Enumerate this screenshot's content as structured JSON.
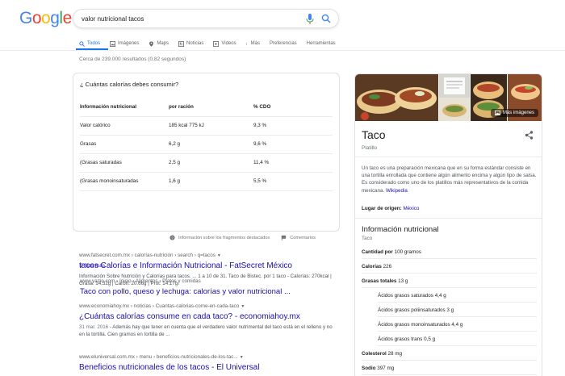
{
  "logo": {
    "letters": [
      "G",
      "o",
      "o",
      "g",
      "l",
      "e"
    ],
    "colors": [
      "#4285F4",
      "#EA4335",
      "#FBBC05",
      "#4285F4",
      "#34A853",
      "#EA4335"
    ]
  },
  "search": {
    "value": "valor nutricional tacos",
    "mic_icon": "mic-icon",
    "search_icon": "search-icon"
  },
  "tabs": [
    {
      "label": "Todos",
      "icon": "search-icon",
      "active": true
    },
    {
      "label": "Imágenes",
      "icon": "image-icon"
    },
    {
      "label": "Maps",
      "icon": "map-pin-icon"
    },
    {
      "label": "Noticias",
      "icon": "news-icon"
    },
    {
      "label": "Videos",
      "icon": "video-icon"
    },
    {
      "label": "Más",
      "icon": "more-icon"
    },
    {
      "label": "Preferencias"
    },
    {
      "label": "Herramientas"
    }
  ],
  "result_stats": "Cerca de 239.000 resultados (0,82 segundos)",
  "featured_snippet": {
    "question": "¿ Cuántas calorías debes consumir?",
    "headers": [
      "Información nutricional",
      "por ración",
      "% CDO"
    ],
    "rows": [
      [
        "Valor calórico",
        "185 kcal 775 kJ",
        "9,3 %"
      ],
      [
        "Grasas",
        "6,2 g",
        "9,6 %"
      ],
      [
        "(Grasas saturadas",
        "2,5 g",
        "11,4 %"
      ],
      [
        "(Grasas monoinsaturadas",
        "1,6 g",
        "5,5 %"
      ]
    ],
    "more_rows": "9 filas más",
    "cite": "www.yazio.com › Inicio › Alimentos › Platos y comidas",
    "title": "Taco con pollo, queso y lechuga: calorías y valor nutricional ..."
  },
  "feedback": {
    "about": "Información sobre los fragmentos destacados",
    "comments": "Comentarios"
  },
  "results": [
    {
      "cite": "www.fatsecret.com.mx › calorías-nutrición › search › q=tacos",
      "title": "tacos Calorías e Información Nutricional - FatSecret México",
      "snippet_date": "",
      "snippet": "Información Sobre Nutrición y Calorías para tacos. ... 1 a 10 de 31. Taco de Bistec. por 1 taco - Calorías: 270kcal | Grasa: 14.52g | Carbh: 20.66g | Prot: 14.17g."
    },
    {
      "cite": "www.economiahoy.mx › noticias › Cuantas-calorias-come-en-cada-taco",
      "title": "¿Cuántas calorías consume en cada taco? - economiahoy.mx",
      "snippet_date": "31 mar. 2016",
      "snippet": " - Además hay que tener en cuenta que el verdadero valor nutrimental del taco está en el relleno y no en la tortilla. Cien gramos en tortilla de ..."
    },
    {
      "cite": "www.eluniversal.com.mx › menu › beneficios-nutricionales-de-los-tac...",
      "title": "Beneficios nutricionales de los tacos - El Universal",
      "snippet_date": "",
      "snippet": ""
    }
  ],
  "knowledge_panel": {
    "more_images": "Más imágenes",
    "title": "Taco",
    "subtitle": "Platillo",
    "description": "Un taco es una preparación mexicana que en su forma estándar consiste en una tortilla enrollada que contiene algún alimento encima y algún tipo de salsa. Es considerado como uno de los platillos más representativos de la comida mexicana.",
    "source": "Wikipedia",
    "origin_label": "Lugar de origen:",
    "origin_value": "México",
    "nutrition_heading": "Información nutricional",
    "nutrition_sub": "Taco",
    "rows": [
      {
        "label": "Cantidad por",
        "value": "100 gramos",
        "sub": false
      },
      {
        "label": "Calorías",
        "value": "226",
        "sub": false
      },
      {
        "label": "Grasas totales",
        "value": "13 g",
        "sub": false
      },
      {
        "label": "Ácidos grasos saturados",
        "value": "4,4 g",
        "sub": true
      },
      {
        "label": "Ácidos grasos poliinsaturados",
        "value": "3 g",
        "sub": true
      },
      {
        "label": "Ácidos grasos monoinsaturados",
        "value": "4,4 g",
        "sub": true
      },
      {
        "label": "Ácidos grasos trans",
        "value": "0,5 g",
        "sub": true
      },
      {
        "label": "Colesterol",
        "value": "28 mg",
        "sub": false
      },
      {
        "label": "Sodio",
        "value": "397 mg",
        "sub": false
      }
    ]
  }
}
